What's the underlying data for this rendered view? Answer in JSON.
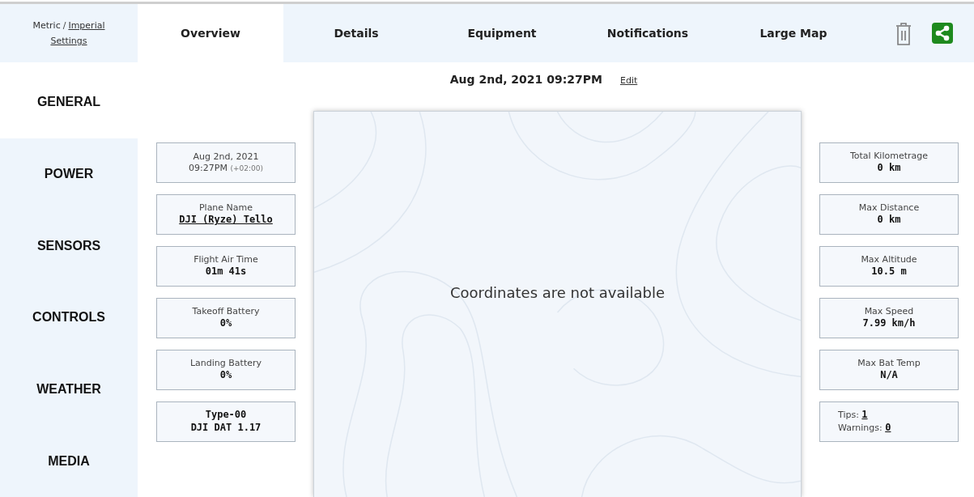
{
  "units": {
    "metric": "Metric",
    "separator": "/",
    "imperial": "Imperial",
    "settings": "Settings"
  },
  "tabs": [
    {
      "label": "Overview",
      "selected": true
    },
    {
      "label": "Details",
      "selected": false
    },
    {
      "label": "Equipment",
      "selected": false
    },
    {
      "label": "Notifications",
      "selected": false
    },
    {
      "label": "Large Map",
      "selected": false
    }
  ],
  "sidebar": {
    "items": [
      {
        "label": "GENERAL",
        "selected": true
      },
      {
        "label": "POWER",
        "selected": false
      },
      {
        "label": "SENSORS",
        "selected": false
      },
      {
        "label": "CONTROLS",
        "selected": false
      },
      {
        "label": "WEATHER",
        "selected": false
      },
      {
        "label": "MEDIA",
        "selected": false
      }
    ]
  },
  "flight_title": {
    "date": "Aug 2nd, 2021 09:27PM",
    "edit": "Edit"
  },
  "left_cards": [
    {
      "kind": "datetime",
      "label": "Aug 2nd, 2021",
      "value": "09:27PM",
      "note": "(+02:00)"
    },
    {
      "kind": "link",
      "label": "Plane Name",
      "value": "DJI (Ryze) Tello"
    },
    {
      "kind": "stat",
      "label": "Flight Air Time",
      "value": "01m 41s"
    },
    {
      "kind": "stat",
      "label": "Takeoff Battery",
      "value": "0%"
    },
    {
      "kind": "stat",
      "label": "Landing Battery",
      "value": "0%"
    },
    {
      "kind": "bold",
      "label": "Type-00",
      "value": "DJI DAT 1.17"
    }
  ],
  "map": {
    "message": "Coordinates are not available"
  },
  "right_cards": [
    {
      "kind": "stat",
      "label": "Total Kilometrage",
      "value": "0 km"
    },
    {
      "kind": "stat",
      "label": "Max Distance",
      "value": "0 km"
    },
    {
      "kind": "stat",
      "label": "Max Altitude",
      "value": "10.5 m"
    },
    {
      "kind": "stat",
      "label": "Max Speed",
      "value": "7.99 km/h"
    },
    {
      "kind": "stat",
      "label": "Max Bat Temp",
      "value": "N/A"
    },
    {
      "kind": "counts",
      "label": "Tips:",
      "value": "1",
      "label2": "Warnings:",
      "value2": "0"
    }
  ]
}
